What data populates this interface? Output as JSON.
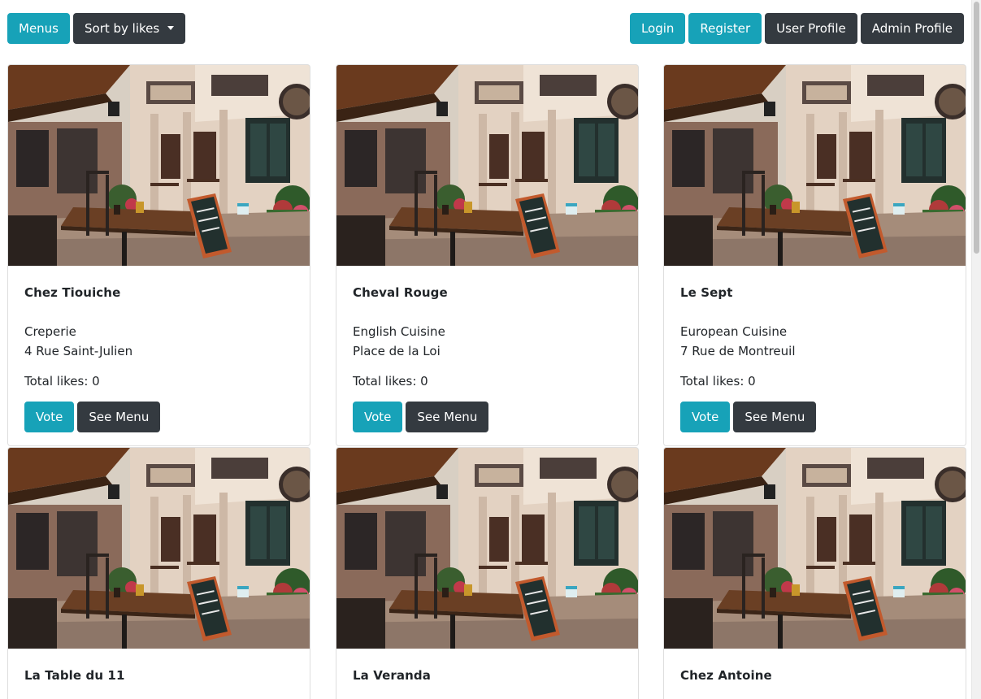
{
  "toolbar": {
    "menus_label": "Menus",
    "sort_label": "Sort by likes",
    "login_label": "Login",
    "register_label": "Register",
    "user_profile_label": "User Profile",
    "admin_profile_label": "Admin Profile"
  },
  "card_labels": {
    "vote": "Vote",
    "see_menu": "See Menu"
  },
  "restaurants": [
    {
      "name": "Chez Tiouiche",
      "cuisine": "Creperie",
      "address": "4 Rue Saint-Julien",
      "likes_text": "Total likes: 0"
    },
    {
      "name": "Cheval Rouge",
      "cuisine": "English Cuisine",
      "address": "Place de la Loi",
      "likes_text": "Total likes: 0"
    },
    {
      "name": "Le Sept",
      "cuisine": "European Cuisine",
      "address": "7 Rue de Montreuil",
      "likes_text": "Total likes: 0"
    },
    {
      "name": "La Table du 11"
    },
    {
      "name": "La Veranda"
    },
    {
      "name": "Chez Antoine"
    }
  ],
  "colors": {
    "info": "#17a2b8",
    "dark": "#343a40"
  },
  "icons": {
    "sort_caret": "caret-down-icon"
  }
}
